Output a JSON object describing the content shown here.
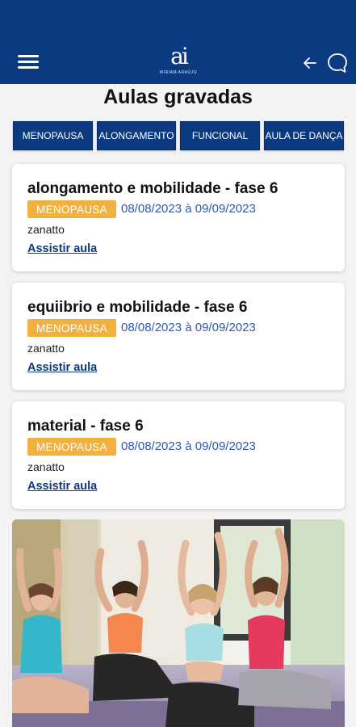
{
  "header": {
    "logo_mark": "ai",
    "logo_text": "MIRIAM ARAÚJO",
    "menu_icon": "hamburger-menu-icon",
    "back_icon": "arrow-left-icon",
    "chat_icon": "chat-bubble-icon",
    "color": "#0c3a80"
  },
  "page": {
    "title": "Aulas gravadas"
  },
  "filters": [
    "MENOPAUSA",
    "ALONGAMENTO",
    "FUNCIONAL",
    "AULA DE DANÇA"
  ],
  "classes": [
    {
      "title": "alongamento e mobilidade - fase 6",
      "category": "MENOPAUSA",
      "dates": "08/08/2023 à 09/09/2023",
      "author": "zanatto",
      "action": "Assistir aula"
    },
    {
      "title": "equiibrio e mobilidade - fase 6",
      "category": "MENOPAUSA",
      "dates": "08/08/2023 à 09/09/2023",
      "author": "zanatto",
      "action": "Assistir aula"
    },
    {
      "title": "material - fase 6",
      "category": "MENOPAUSA",
      "dates": "08/08/2023 à 09/09/2023",
      "author": "zanatto",
      "action": "Assistir aula"
    }
  ],
  "colors": {
    "primary": "#0c3a80",
    "badge": "#f2b13f",
    "date_text": "#2f57b5"
  }
}
